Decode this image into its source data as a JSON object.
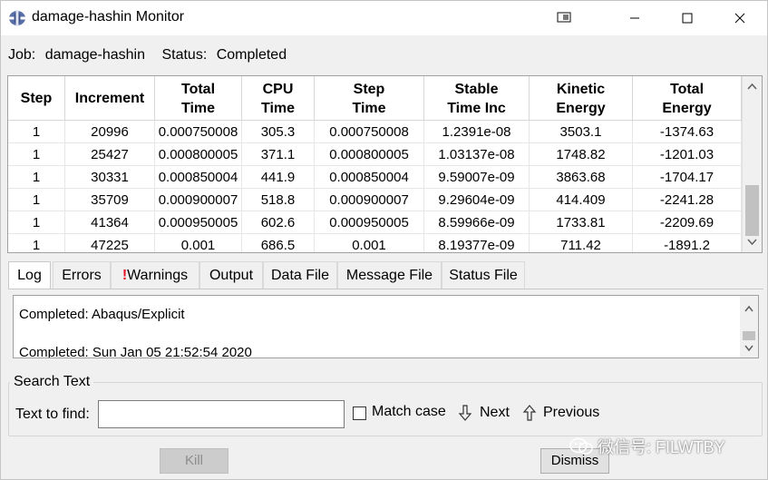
{
  "window": {
    "title": "damage-hashin Monitor",
    "minimize_glyph": "—",
    "maximize_glyph": "☐",
    "close_glyph": "✕"
  },
  "jobline": {
    "job_label": "Job:",
    "job_value": "damage-hashin",
    "status_label": "Status:",
    "status_value": "Completed"
  },
  "table": {
    "headers": [
      [
        "Step"
      ],
      [
        "Increment"
      ],
      [
        "Total",
        "Time"
      ],
      [
        "CPU",
        "Time"
      ],
      [
        "Step",
        "Time"
      ],
      [
        "Stable",
        "Time Inc"
      ],
      [
        "Kinetic",
        "Energy"
      ],
      [
        "Total",
        "Energy"
      ]
    ],
    "rows": [
      [
        "1",
        "20996",
        "0.000750008",
        "305.3",
        "0.000750008",
        "1.2391e-08",
        "3503.1",
        "-1374.63"
      ],
      [
        "1",
        "25427",
        "0.000800005",
        "371.1",
        "0.000800005",
        "1.03137e-08",
        "1748.82",
        "-1201.03"
      ],
      [
        "1",
        "30331",
        "0.000850004",
        "441.9",
        "0.000850004",
        "9.59007e-09",
        "3863.68",
        "-1704.17"
      ],
      [
        "1",
        "35709",
        "0.000900007",
        "518.8",
        "0.000900007",
        "9.29604e-09",
        "414.409",
        "-2241.28"
      ],
      [
        "1",
        "41364",
        "0.000950005",
        "602.6",
        "0.000950005",
        "8.59966e-09",
        "1733.81",
        "-2209.69"
      ],
      [
        "1",
        "47225",
        "0.001",
        "686.5",
        "0.001",
        "8.19377e-09",
        "711.42",
        "-1891.2"
      ]
    ]
  },
  "tabs": [
    {
      "label": "Log",
      "active": true
    },
    {
      "label": "Errors",
      "active": false
    },
    {
      "label": "Warnings",
      "active": false,
      "marker": "!"
    },
    {
      "label": "Output",
      "active": false
    },
    {
      "label": "Data File",
      "active": false
    },
    {
      "label": "Message File",
      "active": false
    },
    {
      "label": "Status File",
      "active": false
    }
  ],
  "log": {
    "lines": [
      "Completed: Abaqus/Explicit",
      "Completed: Sun Jan 05 21:52:54 2020"
    ]
  },
  "search": {
    "group_title": "Search Text",
    "find_label": "Text to find:",
    "find_value": "",
    "match_case_label": "Match case",
    "match_case_checked": false,
    "next_label": "Next",
    "previous_label": "Previous"
  },
  "buttons": {
    "kill_label": "Kill",
    "kill_enabled": false,
    "dismiss_label": "Dismiss"
  },
  "watermark": {
    "text": "微信号: FILWTBY"
  },
  "colors": {
    "warning_marker": "#e81123",
    "window_bg": "#f0f0f0",
    "scroll_thumb": "#c1c1c1"
  }
}
